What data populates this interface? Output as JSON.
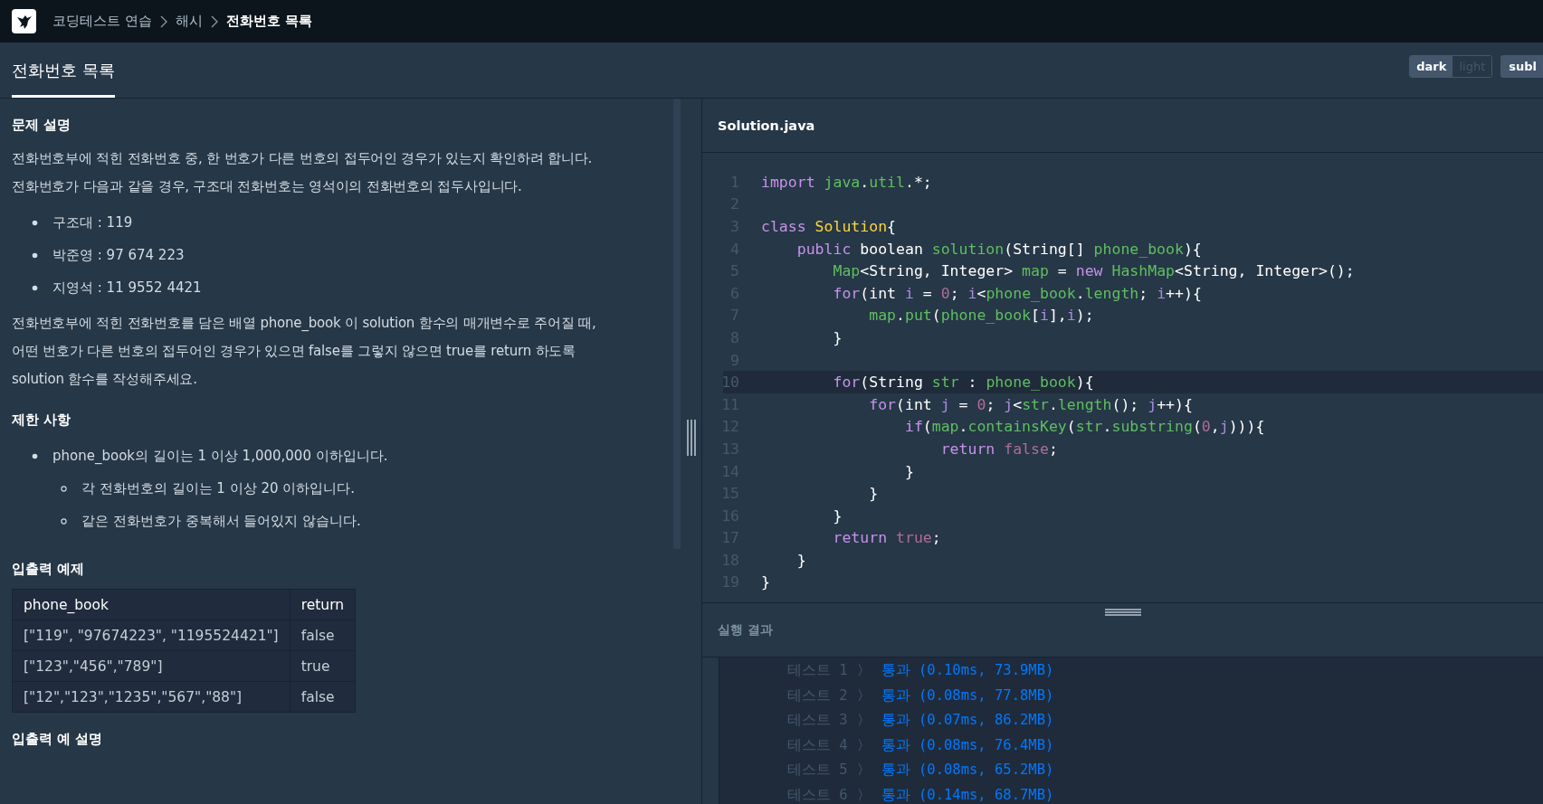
{
  "breadcrumb": [
    {
      "label": "코딩테스트 연습",
      "current": false
    },
    {
      "label": "해시",
      "current": false
    },
    {
      "label": "전화번호 목록",
      "current": true
    }
  ],
  "tabs": [
    {
      "label": "전화번호 목록",
      "selected": true
    }
  ],
  "theme_toggle": [
    {
      "label": "dark",
      "selected": true
    },
    {
      "label": "light",
      "selected": false
    }
  ],
  "submit_button": "subl",
  "problem": {
    "sections": [
      {
        "heading": "문제 설명",
        "blocks": [
          {
            "kind": "paragraph",
            "text": "전화번호부에 적힌 전화번호 중, 한 번호가 다른 번호의 접두어인 경우가 있는지 확인하려 합니다.\n전화번호가 다음과 같을 경우, 구조대 전화번호는 영석이의 전화번호의 접두사입니다."
          },
          {
            "kind": "list",
            "items": [
              {
                "text": "구조대 : 119"
              },
              {
                "text": "박준영 : 97 674 223"
              },
              {
                "text": "지영석 : 11 9552 4421"
              }
            ]
          },
          {
            "kind": "paragraph",
            "text": "전화번호부에 적힌 전화번호를 담은 배열 phone_book 이 solution 함수의 매개변수로 주어질 때,\n어떤 번호가 다른 번호의 접두어인 경우가 있으면 false를 그렇지 않으면 true를 return 하도록\nsolution 함수를 작성해주세요."
          }
        ]
      },
      {
        "heading": "제한 사항",
        "blocks": [
          {
            "kind": "list",
            "items": [
              {
                "text": "phone_book의 길이는 1 이상 1,000,000 이하입니다.",
                "children": [
                  {
                    "text": "각 전화번호의 길이는 1 이상 20 이하입니다."
                  },
                  {
                    "text": "같은 전화번호가 중복해서 들어있지 않습니다."
                  }
                ]
              }
            ]
          }
        ]
      },
      {
        "heading": "입출력 예제",
        "blocks": [
          {
            "kind": "table",
            "columns": [
              "phone_book",
              "return"
            ],
            "rows": [
              [
                "[\"119\", \"97674223\", \"1195524421\"]",
                "false"
              ],
              [
                "[\"123\",\"456\",\"789\"]",
                "true"
              ],
              [
                "[\"12\",\"123\",\"1235\",\"567\",\"88\"]",
                "false"
              ]
            ]
          }
        ]
      },
      {
        "heading": "입출력 예 설명"
      }
    ]
  },
  "editor": {
    "filename": "Solution.java",
    "lines": [
      {
        "number": "1",
        "highlighted": false,
        "tokens": [
          {
            "kind": "keyword",
            "text": "import"
          },
          {
            "kind": "ident",
            "text": " java"
          },
          {
            "kind": "plain",
            "text": "."
          },
          {
            "kind": "ident",
            "text": "util"
          },
          {
            "kind": "plain",
            "text": ".*;"
          }
        ]
      },
      {
        "number": "2",
        "highlighted": false
      },
      {
        "number": "3",
        "highlighted": false,
        "tokens": [
          {
            "kind": "keyword",
            "text": "class"
          },
          {
            "kind": "class",
            "text": " Solution"
          },
          {
            "kind": "plain",
            "text": "{"
          }
        ]
      },
      {
        "number": "4",
        "highlighted": false,
        "tokens": [
          {
            "kind": "keyword",
            "text": "    public"
          },
          {
            "kind": "plain",
            "text": " boolean "
          },
          {
            "kind": "ident",
            "text": "solution"
          },
          {
            "kind": "plain",
            "text": "(String[] "
          },
          {
            "kind": "ident",
            "text": "phone_book"
          },
          {
            "kind": "plain",
            "text": "){"
          }
        ]
      },
      {
        "number": "5",
        "highlighted": false,
        "tokens": [
          {
            "kind": "ident",
            "text": "        Map"
          },
          {
            "kind": "plain",
            "text": "<String, Integer> "
          },
          {
            "kind": "ident",
            "text": "map"
          },
          {
            "kind": "plain",
            "text": " = "
          },
          {
            "kind": "keyword",
            "text": "new"
          },
          {
            "kind": "ident",
            "text": " HashMap"
          },
          {
            "kind": "plain",
            "text": "<String, Integer>();"
          }
        ]
      },
      {
        "number": "6",
        "highlighted": false,
        "tokens": [
          {
            "kind": "keyword",
            "text": "        for"
          },
          {
            "kind": "plain",
            "text": "(int "
          },
          {
            "kind": "var",
            "text": "i"
          },
          {
            "kind": "plain",
            "text": " = "
          },
          {
            "kind": "literal",
            "text": "0"
          },
          {
            "kind": "plain",
            "text": "; "
          },
          {
            "kind": "var",
            "text": "i"
          },
          {
            "kind": "plain",
            "text": "<"
          },
          {
            "kind": "ident",
            "text": "phone_book"
          },
          {
            "kind": "plain",
            "text": "."
          },
          {
            "kind": "ident",
            "text": "length"
          },
          {
            "kind": "plain",
            "text": "; "
          },
          {
            "kind": "var",
            "text": "i"
          },
          {
            "kind": "plain",
            "text": "++){"
          }
        ]
      },
      {
        "number": "7",
        "highlighted": false,
        "tokens": [
          {
            "kind": "ident",
            "text": "            map"
          },
          {
            "kind": "plain",
            "text": "."
          },
          {
            "kind": "ident",
            "text": "put"
          },
          {
            "kind": "plain",
            "text": "("
          },
          {
            "kind": "ident",
            "text": "phone_book"
          },
          {
            "kind": "plain",
            "text": "["
          },
          {
            "kind": "var",
            "text": "i"
          },
          {
            "kind": "plain",
            "text": "],"
          },
          {
            "kind": "var",
            "text": "i"
          },
          {
            "kind": "plain",
            "text": ");"
          }
        ]
      },
      {
        "number": "8",
        "highlighted": false,
        "tokens": [
          {
            "kind": "plain",
            "text": "        }"
          }
        ]
      },
      {
        "number": "9",
        "highlighted": false
      },
      {
        "number": "10",
        "highlighted": true,
        "tokens": [
          {
            "kind": "keyword",
            "text": "        for"
          },
          {
            "kind": "plain",
            "text": "(String "
          },
          {
            "kind": "ident",
            "text": "str"
          },
          {
            "kind": "plain",
            "text": " : "
          },
          {
            "kind": "ident",
            "text": "phone_book"
          },
          {
            "kind": "plain",
            "text": "){"
          }
        ]
      },
      {
        "number": "11",
        "highlighted": false,
        "tokens": [
          {
            "kind": "keyword",
            "text": "            for"
          },
          {
            "kind": "plain",
            "text": "(int "
          },
          {
            "kind": "var",
            "text": "j"
          },
          {
            "kind": "plain",
            "text": " = "
          },
          {
            "kind": "literal",
            "text": "0"
          },
          {
            "kind": "plain",
            "text": "; "
          },
          {
            "kind": "var",
            "text": "j"
          },
          {
            "kind": "plain",
            "text": "<"
          },
          {
            "kind": "ident",
            "text": "str"
          },
          {
            "kind": "plain",
            "text": "."
          },
          {
            "kind": "ident",
            "text": "length"
          },
          {
            "kind": "plain",
            "text": "(); "
          },
          {
            "kind": "var",
            "text": "j"
          },
          {
            "kind": "plain",
            "text": "++){"
          }
        ]
      },
      {
        "number": "12",
        "highlighted": false,
        "tokens": [
          {
            "kind": "keyword",
            "text": "                if"
          },
          {
            "kind": "plain",
            "text": "("
          },
          {
            "kind": "ident",
            "text": "map"
          },
          {
            "kind": "plain",
            "text": "."
          },
          {
            "kind": "ident",
            "text": "containsKey"
          },
          {
            "kind": "plain",
            "text": "("
          },
          {
            "kind": "ident",
            "text": "str"
          },
          {
            "kind": "plain",
            "text": "."
          },
          {
            "kind": "ident",
            "text": "substring"
          },
          {
            "kind": "plain",
            "text": "("
          },
          {
            "kind": "literal",
            "text": "0"
          },
          {
            "kind": "plain",
            "text": ","
          },
          {
            "kind": "var",
            "text": "j"
          },
          {
            "kind": "plain",
            "text": "))){"
          }
        ]
      },
      {
        "number": "13",
        "highlighted": false,
        "tokens": [
          {
            "kind": "keyword",
            "text": "                    return"
          },
          {
            "kind": "literal",
            "text": " false"
          },
          {
            "kind": "plain",
            "text": ";"
          }
        ]
      },
      {
        "number": "14",
        "highlighted": false,
        "tokens": [
          {
            "kind": "plain",
            "text": "                }"
          }
        ]
      },
      {
        "number": "15",
        "highlighted": false,
        "tokens": [
          {
            "kind": "plain",
            "text": "            }"
          }
        ]
      },
      {
        "number": "16",
        "highlighted": false,
        "tokens": [
          {
            "kind": "plain",
            "text": "        }"
          }
        ]
      },
      {
        "number": "17",
        "highlighted": false,
        "tokens": [
          {
            "kind": "keyword",
            "text": "        return"
          },
          {
            "kind": "literal",
            "text": " true"
          },
          {
            "kind": "plain",
            "text": ";"
          }
        ]
      },
      {
        "number": "18",
        "highlighted": false,
        "tokens": [
          {
            "kind": "plain",
            "text": "    }"
          }
        ]
      },
      {
        "number": "19",
        "highlighted": false,
        "tokens": [
          {
            "kind": "plain",
            "text": "}"
          }
        ]
      }
    ]
  },
  "results": {
    "title": "실행 결과",
    "rows": [
      {
        "label": "테스트 1",
        "arrow": "〉",
        "result": "통과 (0.10ms, 73.9MB)"
      },
      {
        "label": "테스트 2",
        "arrow": "〉",
        "result": "통과 (0.08ms, 77.8MB)"
      },
      {
        "label": "테스트 3",
        "arrow": "〉",
        "result": "통과 (0.07ms, 86.2MB)"
      },
      {
        "label": "테스트 4",
        "arrow": "〉",
        "result": "통과 (0.08ms, 76.4MB)"
      },
      {
        "label": "테스트 5",
        "arrow": "〉",
        "result": "통과 (0.08ms, 65.2MB)"
      },
      {
        "label": "테스트 6",
        "arrow": "〉",
        "result": "통과 (0.14ms, 68.7MB)"
      }
    ]
  }
}
